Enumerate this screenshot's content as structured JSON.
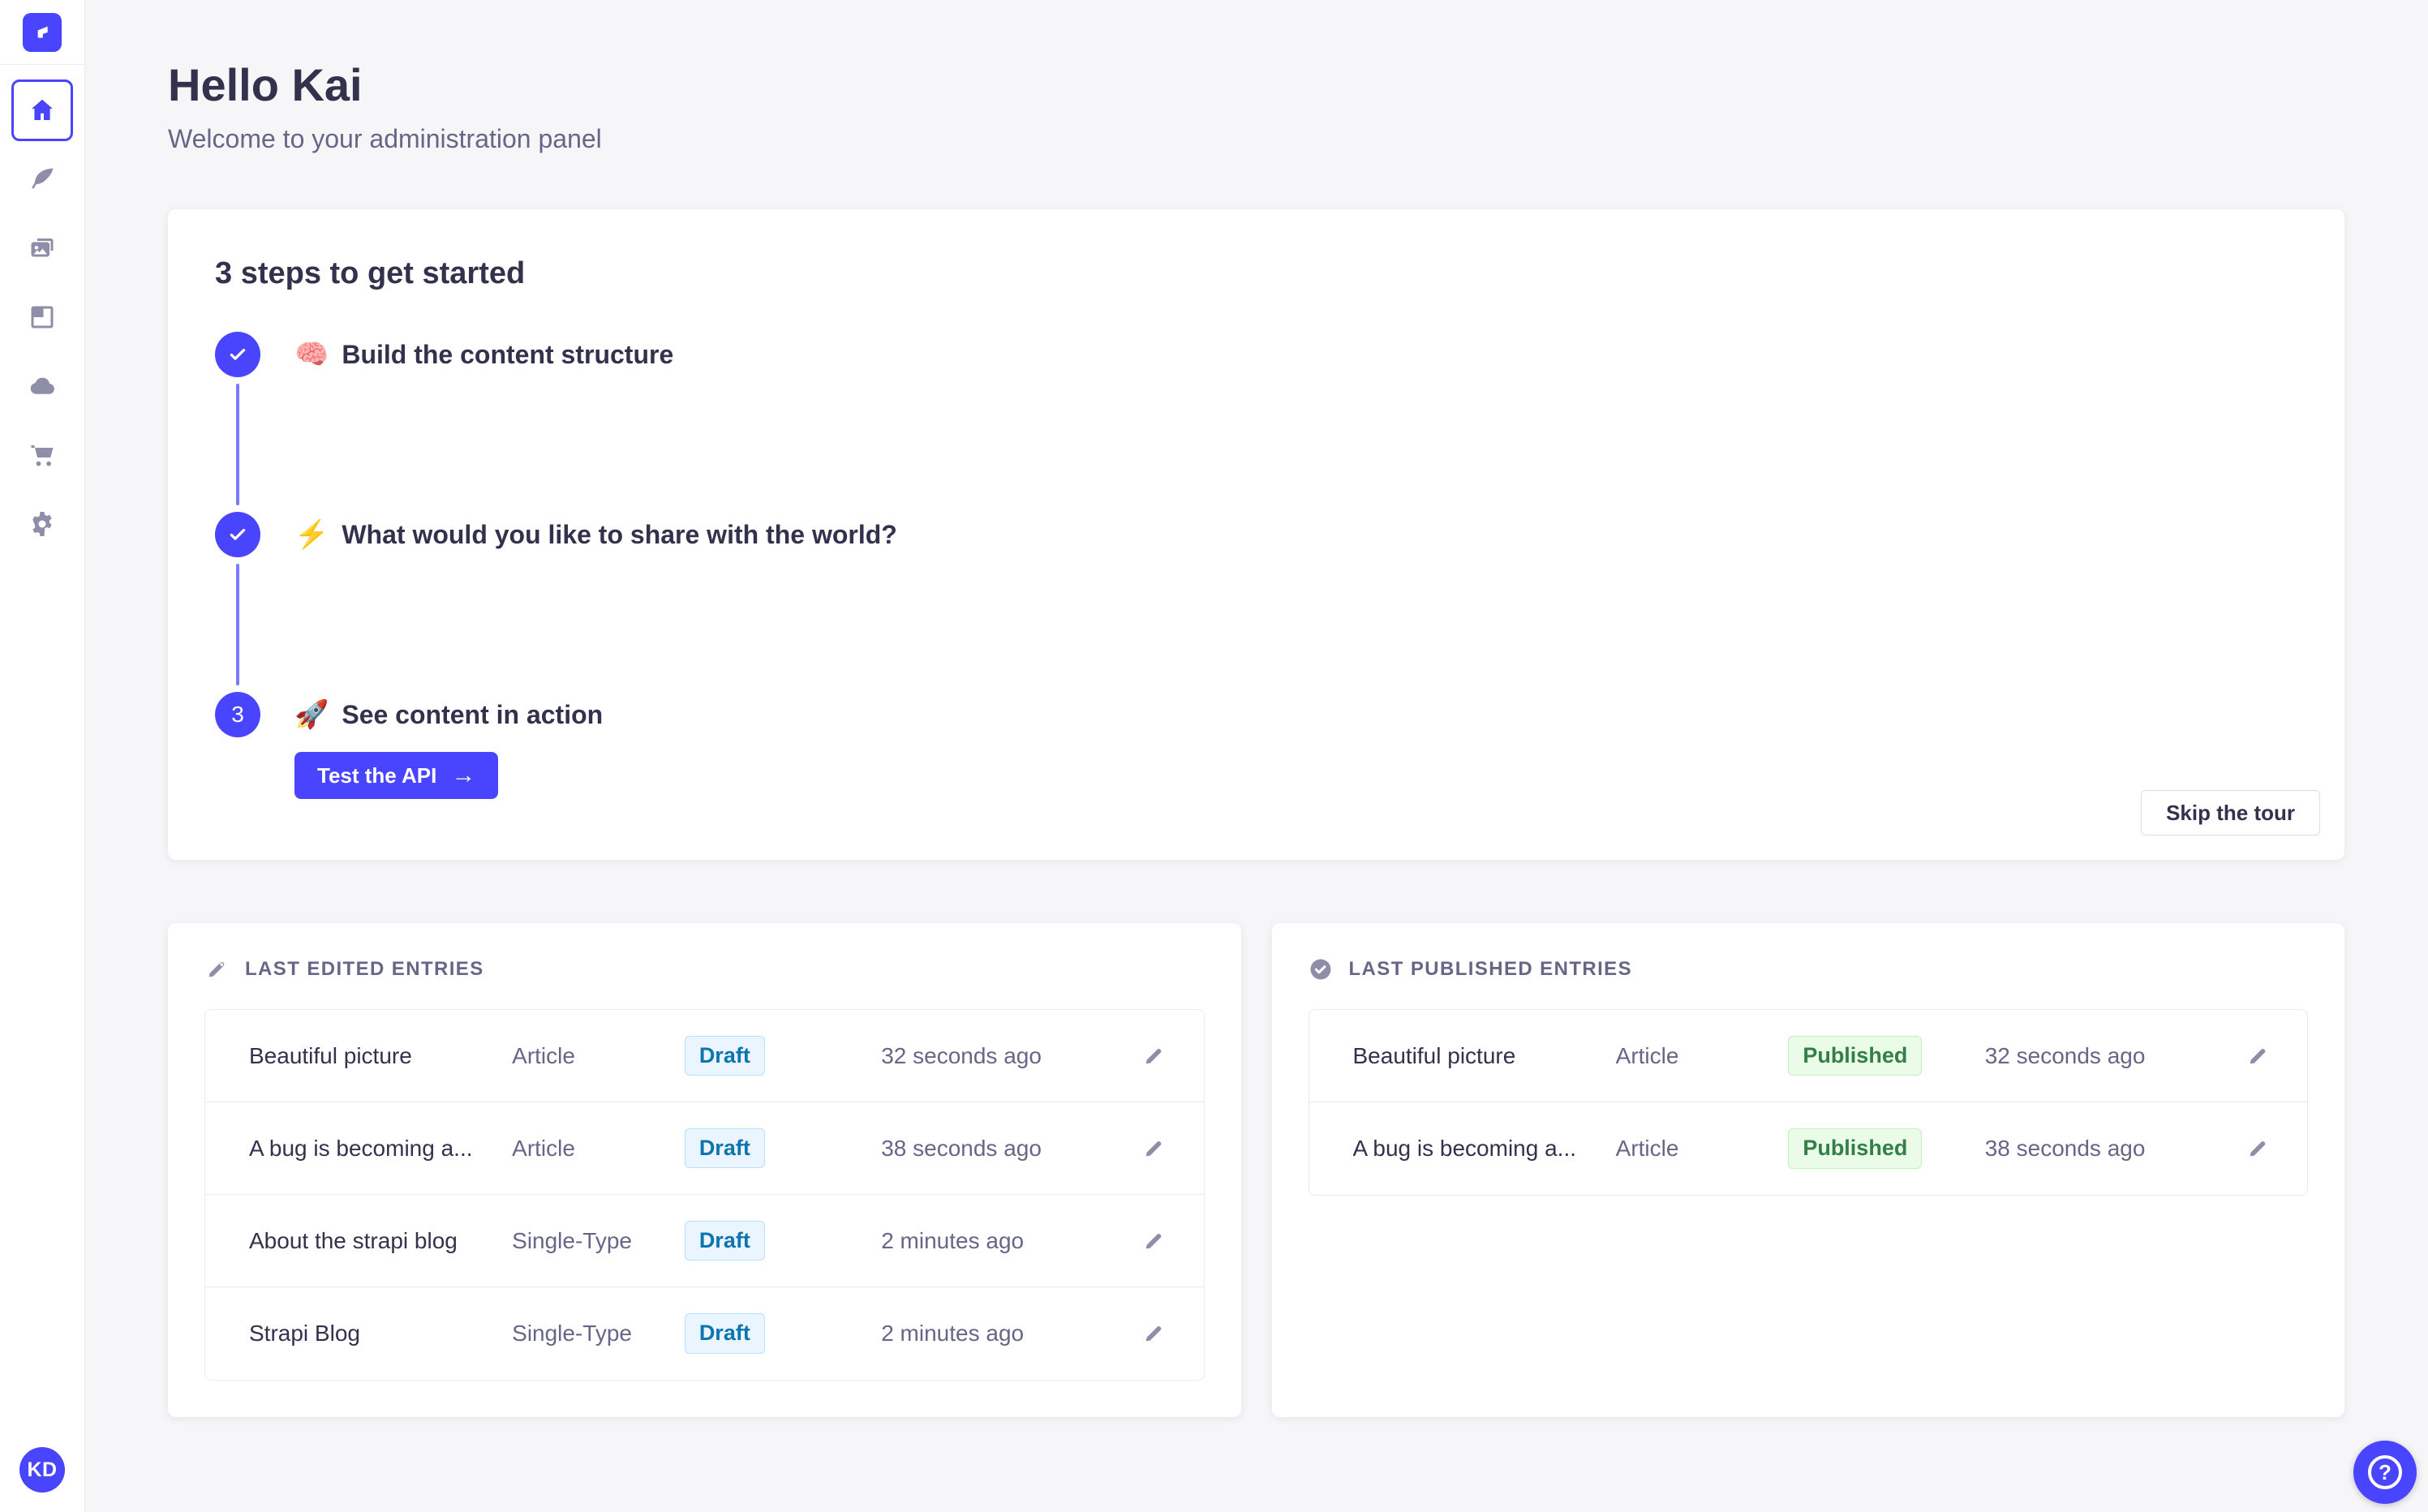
{
  "colors": {
    "primary": "#4945ff",
    "primary_light": "#7b79ff",
    "text_dark": "#32324d",
    "text_muted": "#666687",
    "icon_gray": "#8e8ea9",
    "page_bg": "#f6f6f9",
    "border": "#eaeaef",
    "draft_bg": "#eaf5ff",
    "draft_border": "#b8e1ff",
    "draft_text": "#0c75af",
    "published_bg": "#eafbe7",
    "published_border": "#c6f0c2",
    "published_text": "#328048"
  },
  "icons": {
    "check": "✓",
    "arrow_right": "→",
    "help": "?"
  },
  "sidebar": {
    "items": [
      "home",
      "content-manager",
      "media-library",
      "content-type-builder",
      "cloud",
      "marketplace",
      "settings"
    ],
    "avatar_initials": "KD"
  },
  "header": {
    "title": "Hello Kai",
    "subtitle": "Welcome to your administration panel"
  },
  "tour": {
    "title": "3 steps to get started",
    "steps": [
      {
        "status": "done",
        "emoji": "🧠",
        "label": "Build the content structure"
      },
      {
        "status": "done",
        "emoji": "⚡",
        "label": "What would you like to share with the world?"
      },
      {
        "status": "current",
        "number": "3",
        "emoji": "🚀",
        "label": "See content in action",
        "cta": "Test the API"
      }
    ],
    "skip_label": "Skip the tour"
  },
  "widgets": {
    "last_edited": {
      "title": "LAST EDITED ENTRIES",
      "rows": [
        {
          "title": "Beautiful picture",
          "type": "Article",
          "status": "Draft",
          "time": "32 seconds ago"
        },
        {
          "title": "A bug is becoming a...",
          "type": "Article",
          "status": "Draft",
          "time": "38 seconds ago"
        },
        {
          "title": "About the strapi blog",
          "type": "Single-Type",
          "status": "Draft",
          "time": "2 minutes ago"
        },
        {
          "title": "Strapi Blog",
          "type": "Single-Type",
          "status": "Draft",
          "time": "2 minutes ago"
        }
      ]
    },
    "last_published": {
      "title": "LAST PUBLISHED ENTRIES",
      "rows": [
        {
          "title": "Beautiful picture",
          "type": "Article",
          "status": "Published",
          "time": "32 seconds ago"
        },
        {
          "title": "A bug is becoming a...",
          "type": "Article",
          "status": "Published",
          "time": "38 seconds ago"
        }
      ]
    }
  }
}
